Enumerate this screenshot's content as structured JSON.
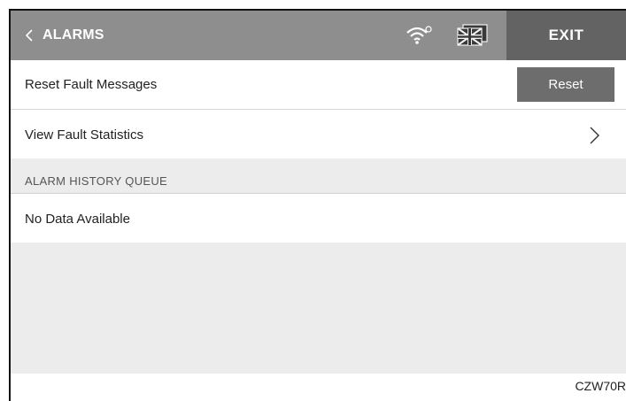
{
  "header": {
    "back_label": "ALARMS",
    "exit_label": "EXIT",
    "icons": [
      "chevron-left-icon",
      "wifi-icon",
      "flag-icon"
    ]
  },
  "rows": {
    "reset_fault": {
      "label": "Reset Fault Messages",
      "button_label": "Reset"
    },
    "view_stats": {
      "label": "View Fault Statistics",
      "icon": "chevron-right-icon"
    }
  },
  "alarm_history": {
    "section_title": "ALARM HISTORY QUEUE",
    "empty_text": "No Data Available"
  },
  "figure_code": "CZW70R",
  "colors": {
    "header_bg": "#8e8e8e",
    "exit_bg": "#636363",
    "reset_button_bg": "#6d6d6d",
    "section_bg": "#ececec",
    "text": "#222222"
  }
}
